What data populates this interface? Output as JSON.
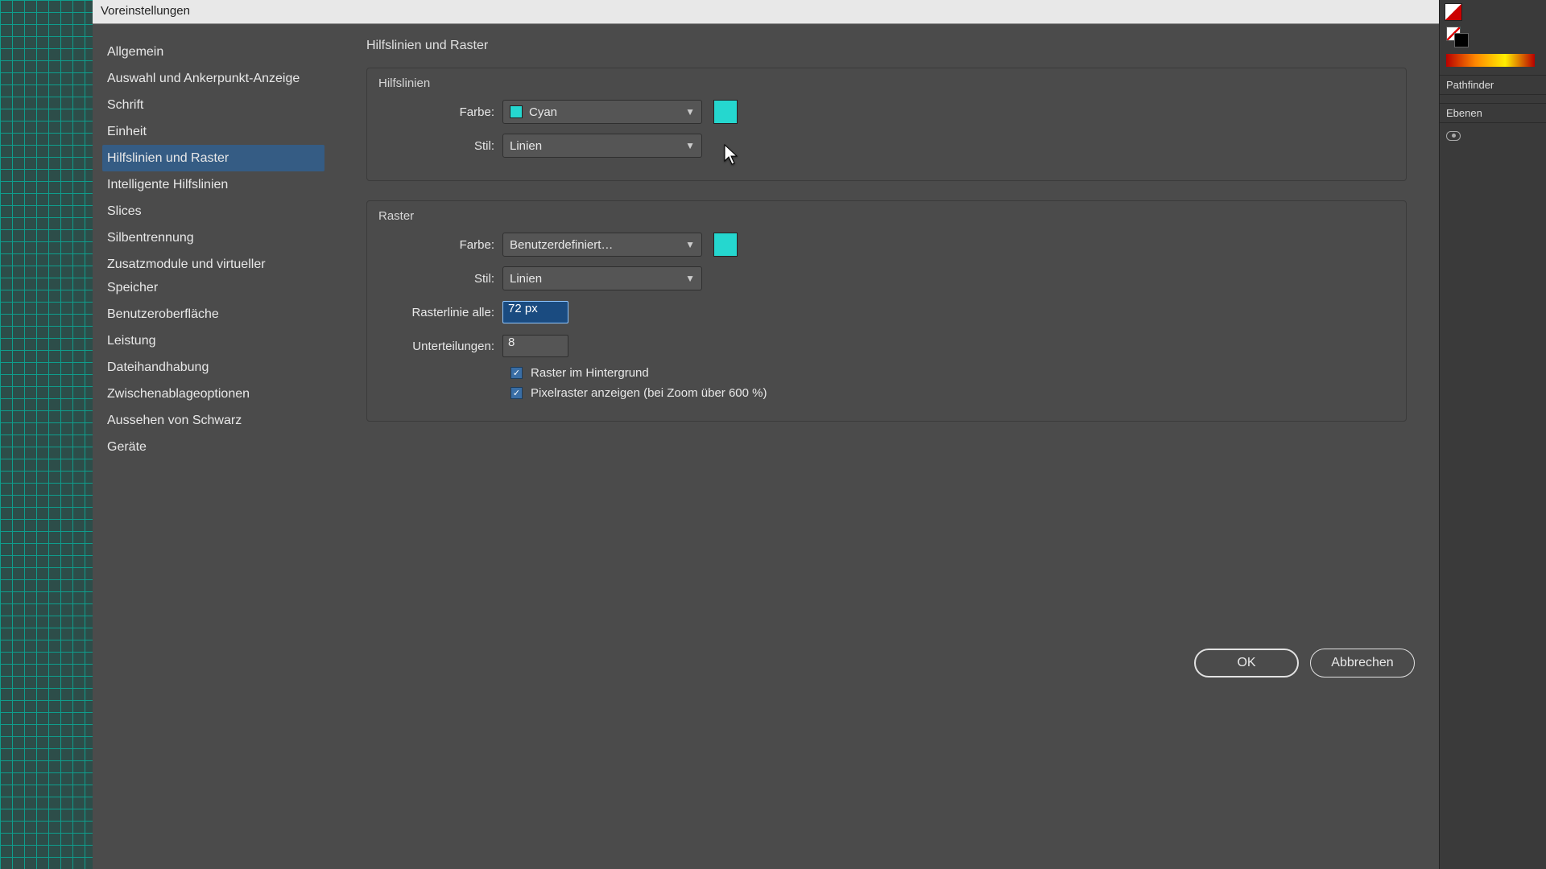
{
  "dialog": {
    "title": "Voreinstellungen"
  },
  "sidebar": {
    "items": [
      "Allgemein",
      "Auswahl und Ankerpunkt-Anzeige",
      "Schrift",
      "Einheit",
      "Hilfslinien und Raster",
      "Intelligente Hilfslinien",
      "Slices",
      "Silbentrennung",
      "Zusatzmodule und virtueller Speicher",
      "Benutzeroberfläche",
      "Leistung",
      "Dateihandhabung",
      "Zwischenablageoptionen",
      "Aussehen von Schwarz",
      "Geräte"
    ],
    "selected_index": 4
  },
  "page": {
    "title": "Hilfslinien und Raster"
  },
  "guides": {
    "group_title": "Hilfslinien",
    "color_label": "Farbe:",
    "color_value": "Cyan",
    "color_swatch": "#25d7cf",
    "style_label": "Stil:",
    "style_value": "Linien"
  },
  "grid": {
    "group_title": "Raster",
    "color_label": "Farbe:",
    "color_value": "Benutzerdefiniert…",
    "color_swatch": "#25d7cf",
    "style_label": "Stil:",
    "style_value": "Linien",
    "gridline_label": "Rasterlinie alle:",
    "gridline_value": "72 px",
    "subdiv_label": "Unterteilungen:",
    "subdiv_value": "8",
    "cb_back_label": "Raster im Hintergrund",
    "cb_pixel_label": "Pixelraster anzeigen (bei Zoom über 600 %)"
  },
  "buttons": {
    "ok": "OK",
    "cancel": "Abbrechen"
  },
  "dock": {
    "pathfinder": "Pathfinder",
    "layers": "Ebenen"
  }
}
